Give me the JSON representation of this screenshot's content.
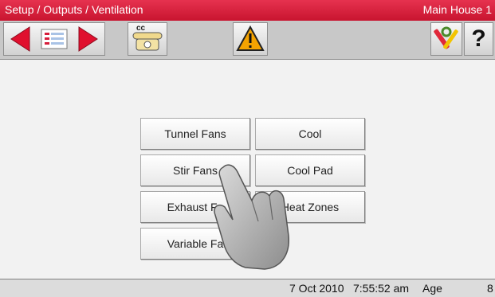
{
  "title_bar": {
    "breadcrumb": "Setup / Outputs / Ventilation",
    "location": "Main House 1",
    "color": "#d61d3a"
  },
  "toolbar": {
    "prev_icon": "arrow-left-icon",
    "list_icon": "document-list-icon",
    "next_icon": "arrow-right-icon",
    "cc_label": "cc",
    "phone_icon": "telephone-icon",
    "warning_icon": "warning-triangle-icon",
    "tools_icon": "wrench-tools-icon",
    "help_label": "?"
  },
  "menu": {
    "tunnel_fans": "Tunnel Fans",
    "cool": "Cool",
    "stir_fans": "Stir Fans",
    "cool_pad": "Cool Pad",
    "exhaust_fans": "Exhaust Fa",
    "heat_zones": "Heat Zones",
    "variable_fans": "Variable Fa"
  },
  "status_bar": {
    "date": "7 Oct 2010",
    "time": "7:55:52 am",
    "age_label": "Age",
    "age_value": "8"
  }
}
